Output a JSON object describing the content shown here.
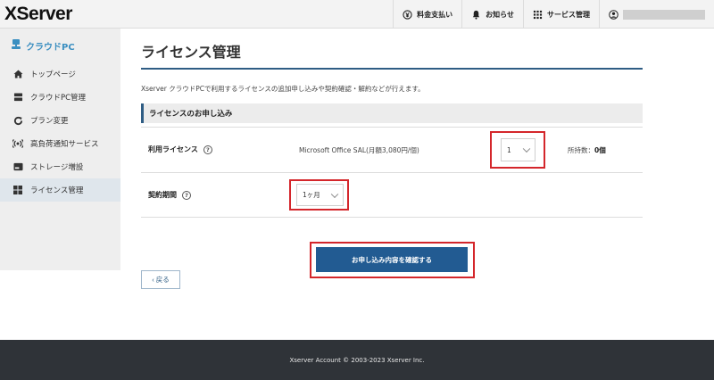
{
  "header": {
    "logo": "XServer",
    "nav": [
      {
        "label": "料金支払い",
        "icon": "yen-circle-icon"
      },
      {
        "label": "お知らせ",
        "icon": "bell-icon"
      },
      {
        "label": "サービス管理",
        "icon": "grid-icon"
      }
    ],
    "user_icon": "user-icon"
  },
  "sidebar": {
    "brand": "クラウドPC",
    "items": [
      {
        "label": "トップページ",
        "icon": "home-icon"
      },
      {
        "label": "クラウドPC管理",
        "icon": "server-icon"
      },
      {
        "label": "プラン変更",
        "icon": "refresh-icon"
      },
      {
        "label": "高負荷通知サービス",
        "icon": "signal-icon"
      },
      {
        "label": "ストレージ増設",
        "icon": "storage-icon"
      },
      {
        "label": "ライセンス管理",
        "icon": "windows-icon"
      }
    ]
  },
  "main": {
    "title": "ライセンス管理",
    "description": "Xserver クラウドPCで利用するライセンスの追加申し込みや契約確認・解約などが行えます。",
    "section_title": "ライセンスのお申し込み",
    "license_row": {
      "label": "利用ライセンス",
      "help": "?",
      "product": "Microsoft Office SAL(月額3,080円/個)",
      "quantity": "1",
      "stock_label": "所持数：",
      "stock_value": "0個"
    },
    "term_row": {
      "label": "契約期間",
      "help": "?",
      "period": "1ヶ月"
    },
    "confirm_button": "お申し込み内容を確認する",
    "back_button": "‹ 戻る"
  },
  "footer": {
    "copyright": "Xserver Account © 2003-2023 Xserver Inc."
  },
  "colors": {
    "accent": "#225b92",
    "highlight": "#d4262b",
    "brand": "#3b8fc1"
  }
}
